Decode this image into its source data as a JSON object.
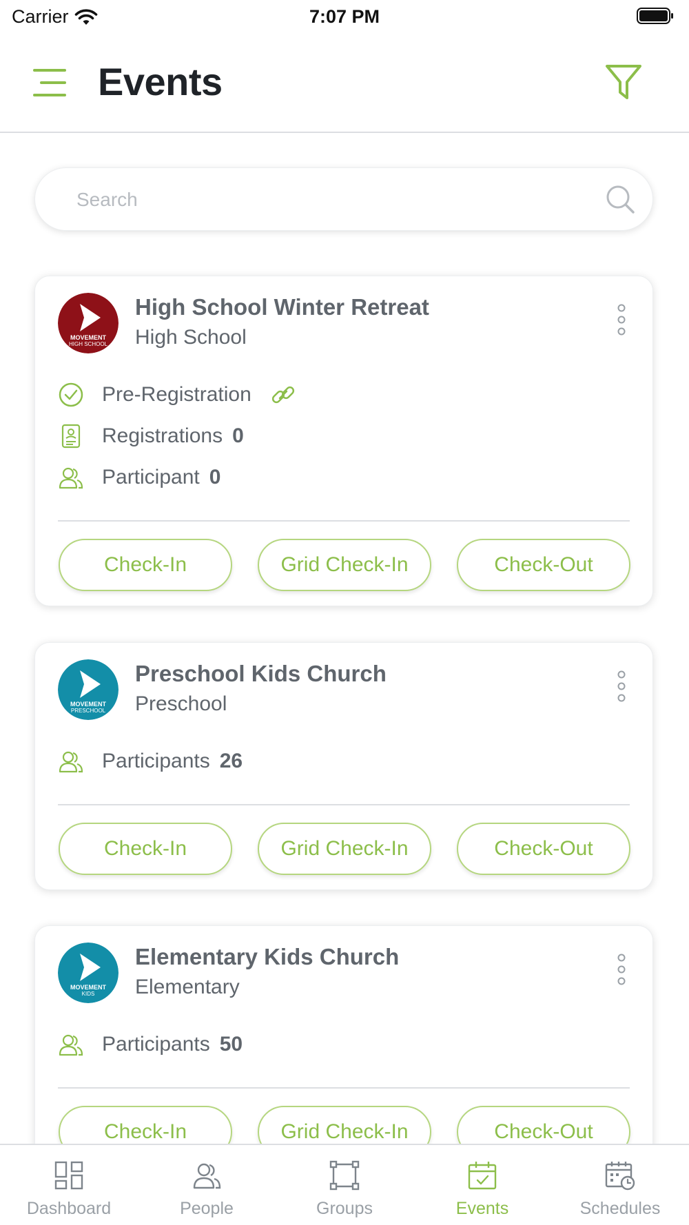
{
  "status_bar": {
    "carrier": "Carrier",
    "time": "7:07 PM"
  },
  "header": {
    "title": "Events",
    "menu_icon": "hamburger-menu-icon",
    "filter_icon": "filter-funnel-icon"
  },
  "search": {
    "placeholder": "Search",
    "value": ""
  },
  "colors": {
    "accent": "#8cbe4a",
    "accent_border": "#b5d67f",
    "text": "#5f656c",
    "title": "#1f2328",
    "high_school_logo": "#8e1118",
    "teal_logo": "#138ea8"
  },
  "events": [
    {
      "title": "High School Winter Retreat",
      "subtitle": "High School",
      "logo": {
        "brand": "MOVEMENT",
        "sub": "HIGH SCHOOL",
        "color": "#8e1118"
      },
      "pre_registration": "Pre-Registration",
      "registrations_label": "Registrations",
      "registrations_count": "0",
      "participants_label": "Participant",
      "participants_count": "0",
      "buttons": [
        "Check-In",
        "Grid Check-In",
        "Check-Out"
      ]
    },
    {
      "title": "Preschool Kids Church",
      "subtitle": "Preschool",
      "logo": {
        "brand": "MOVEMENT",
        "sub": "PRESCHOOL",
        "color": "#138ea8"
      },
      "participants_label": "Participants",
      "participants_count": "26",
      "buttons": [
        "Check-In",
        "Grid Check-In",
        "Check-Out"
      ]
    },
    {
      "title": "Elementary Kids Church",
      "subtitle": "Elementary",
      "logo": {
        "brand": "MOVEMENT",
        "sub": "KIDS",
        "color": "#138ea8"
      },
      "participants_label": "Participants",
      "participants_count": "50",
      "buttons": [
        "Check-In",
        "Grid Check-In",
        "Check-Out"
      ]
    }
  ],
  "bottom_nav": {
    "items": [
      {
        "label": "Dashboard",
        "icon": "dashboard-grid-icon",
        "active": false
      },
      {
        "label": "People",
        "icon": "people-icon",
        "active": false
      },
      {
        "label": "Groups",
        "icon": "groups-icon",
        "active": false
      },
      {
        "label": "Events",
        "icon": "calendar-check-icon",
        "active": true
      },
      {
        "label": "Schedules",
        "icon": "calendar-clock-icon",
        "active": false
      }
    ]
  }
}
